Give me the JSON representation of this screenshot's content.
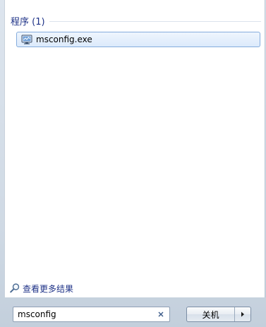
{
  "results": {
    "group_title": "程序 (1)",
    "items": [
      {
        "label": "msconfig.exe",
        "icon": "msconfig-icon"
      }
    ]
  },
  "footer": {
    "see_more_label": "查看更多结果",
    "see_more_icon": "search-icon"
  },
  "search": {
    "value": "msconfig",
    "clear_icon": "close-icon"
  },
  "power": {
    "shutdown_label": "关机",
    "options_icon": "chevron-right-icon"
  },
  "colors": {
    "accent_text": "#1e3287",
    "selection_border": "#84acdd"
  }
}
